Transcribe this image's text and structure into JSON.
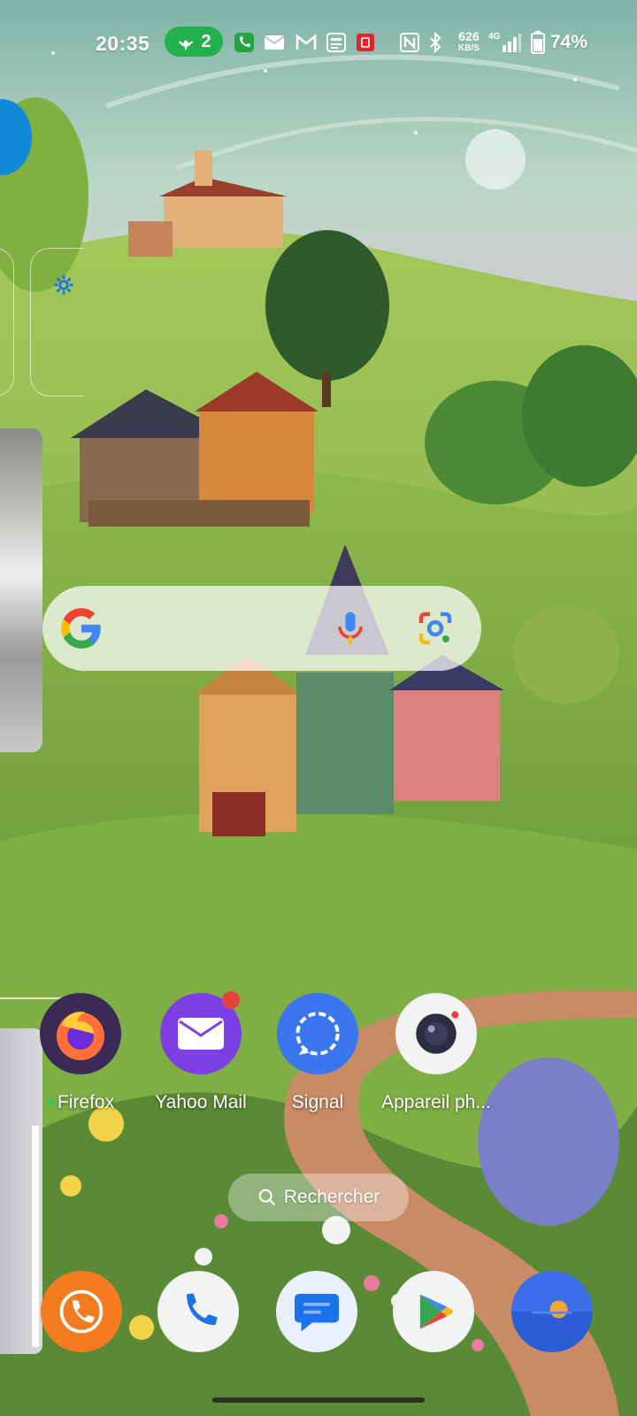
{
  "status_bar": {
    "time": "20:35",
    "hotspot_count": "2",
    "net_speed_value": "626",
    "net_speed_unit": "KB/S",
    "network_type": "4G",
    "battery": "74%"
  },
  "search_widget": {
    "google_letter": "G"
  },
  "apps": [
    {
      "label": "Firefox",
      "icon": "firefox-icon"
    },
    {
      "label": "Yahoo Mail",
      "icon": "mail-icon"
    },
    {
      "label": "Signal",
      "icon": "signal-icon"
    },
    {
      "label": "Appareil ph...",
      "icon": "camera-icon"
    }
  ],
  "app_search": {
    "label": "Rechercher"
  },
  "dock": [
    {
      "icon": "call-app-icon"
    },
    {
      "icon": "phone-icon"
    },
    {
      "icon": "messages-icon"
    },
    {
      "icon": "play-store-icon"
    },
    {
      "icon": "weather-icon"
    }
  ],
  "colors": {
    "hotspot": "#22b14c",
    "firefox_bg": "#3a2a55",
    "yahoo": "#7b3fe4",
    "signal": "#3a76f0",
    "call_app": "#f47b20",
    "weather": "#3b6ee8"
  }
}
